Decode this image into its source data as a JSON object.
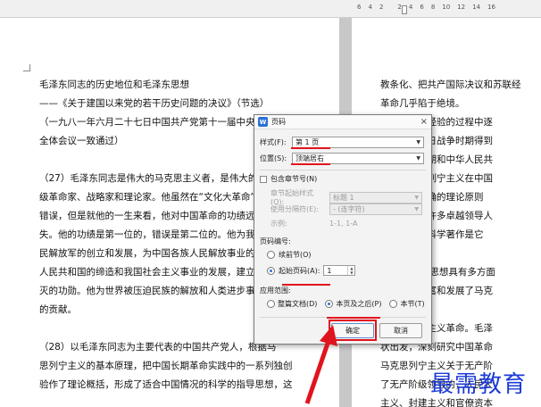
{
  "ruler": {
    "ticks": [
      "6",
      "4",
      "2",
      "",
      "2",
      "4",
      "6",
      "8",
      "10",
      "12",
      "14",
      "16"
    ]
  },
  "left_page": {
    "lines": [
      "毛泽东同志的历史地位和毛泽东思想",
      "——《关于建国以来党的若干历史问题的决议》（节选）",
      "（一九八一年六月二十七日中国共产党第十一届中央委员会",
      "全体会议一致通过）",
      "",
      "（27）毛泽东同志是伟大的马克思主义者，是伟大的无",
      "级革命家、战略家和理论家。他虽然在“文化大革命”中犯",
      "错误，但是就他的一生来看，他对中国革命的功绩远远大于",
      "失。他的功绩是第一位的，错误是第二位的。他为我们党和",
      "民解放军的创立和发展，为中国各族人民解放事业的胜利，",
      "人民共和国的缔造和我国社会主义事业的发展，建立了永",
      "灭的功勋。他为世界被压迫民族的解放和人类进步事业作",
      "的贡献。",
      "",
      "（28）以毛泽东同志为主要代表的中国共产党人，根据马",
      "思列宁主义的基本原理，把中国长期革命实践中的一系列独创",
      "验作了理论概括，形成了适合中国情况的科学的指导思想，这"
    ]
  },
  "right_page": {
    "lines": [
      "教条化、把共产国际决议和苏联经",
      "革命几乎陷于绝境。",
      "方面的历史经验的过程中逐",
      "争后期和抗日战争时期得到",
      "解放战争时期和中华人民共",
      "思是马克思列宁主义在中国",
      "国革命的正确的理论原则",
      "结晶。我党许多卓越领导人",
      "泽东同志的科学著作是它",
      "",
      "29）毛泽东思想具有多方面",
      "他的理论丰富和发展了马克",
      "",
      "关于新民主主义革命。毛泽",
      "状出发，深刻研究中国革命",
      "马克思列宁主义关于无产阶",
      "了无产阶级领导的，人民大",
      "主义、封建主义和官僚资本"
    ]
  },
  "dialog": {
    "title": "页码",
    "close": "×",
    "style_label": "样式(F):",
    "style_value": "第 1 页",
    "position_label": "位置(S):",
    "position_value": "顶端居右",
    "include_chapter_label": "包含章节号(N)",
    "chapter_style_label": "章节起始样式(Q):",
    "chapter_style_value": "标题 1",
    "separator_label": "使用分隔符(E):",
    "separator_value": "-  (连字符)",
    "example_label": "示例:",
    "example_value": "1-1, 1-A",
    "numbering_section": "页码编号:",
    "continue_label": "续前节(O)",
    "start_at_label": "起始页码(A):",
    "start_at_value": "1",
    "apply_section": "应用范围:",
    "scope_whole": "整篇文档(D)",
    "scope_this_and_after": "本页及之后(P)",
    "scope_this_section": "本节(T)",
    "ok": "确定",
    "cancel": "取消"
  },
  "watermark": "最需教育",
  "colors": {
    "highlight": "#e0141e",
    "accent": "#2b6fd6"
  }
}
